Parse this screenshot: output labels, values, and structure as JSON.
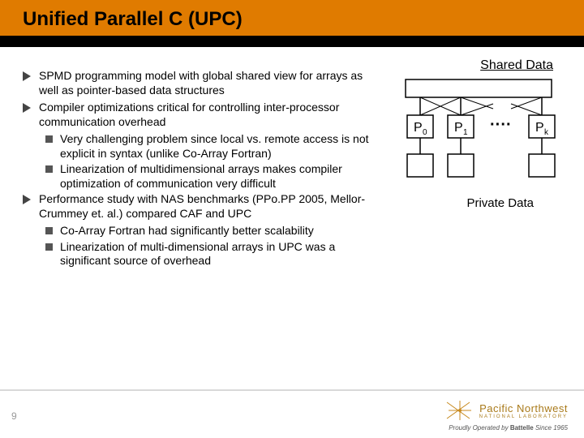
{
  "title": "Unified Parallel C (UPC)",
  "bullets": [
    {
      "text": "SPMD programming model with global shared view for arrays as well as pointer-based data structures",
      "sub": []
    },
    {
      "text": "Compiler optimizations critical for controlling inter-processor communication overhead",
      "sub": [
        "Very challenging problem since local vs. remote access is not explicit in syntax (unlike Co-Array Fortran)",
        "Linearization of multidimensional arrays makes compiler optimization of communication very difficult"
      ]
    },
    {
      "text": "Performance study with NAS benchmarks (PPo.PP 2005, Mellor-Crummey et. al.) compared CAF and UPC",
      "sub": [
        "Co-Array Fortran had significantly better scalability",
        "Linearization of multi-dimensional arrays in UPC was a significant source of overhead"
      ]
    }
  ],
  "diagram": {
    "shared_label": "Shared Data",
    "private_label": "Private Data",
    "procs": [
      "P",
      "P",
      "P"
    ],
    "proc_subs": [
      "0",
      "1",
      "k"
    ],
    "dots": "····"
  },
  "slide_number": "9",
  "logo": {
    "brand": "Pacific Northwest",
    "sub": "NATIONAL LABORATORY",
    "operator_prefix": "Proudly Operated by ",
    "operator": "Battelle",
    "operator_suffix": " Since 1965"
  }
}
